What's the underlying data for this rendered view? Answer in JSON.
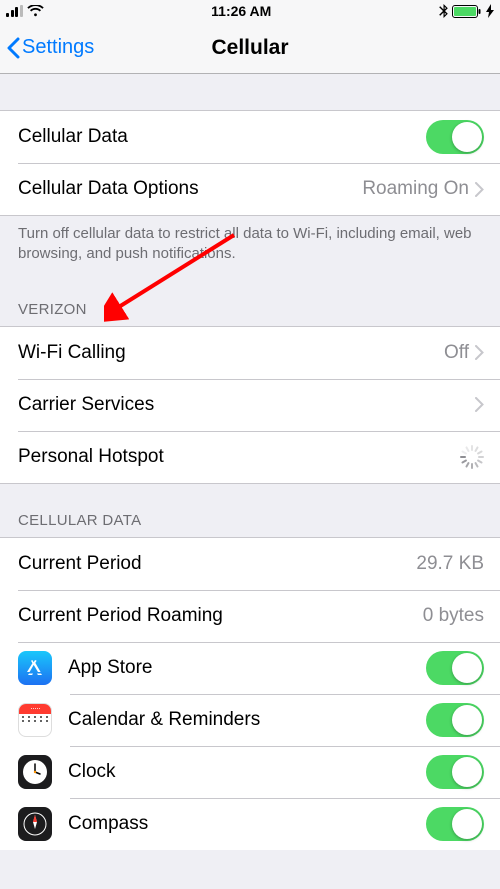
{
  "status": {
    "time": "11:26 AM"
  },
  "nav": {
    "back": "Settings",
    "title": "Cellular"
  },
  "group1": {
    "cellular_data": "Cellular Data",
    "cellular_data_options": "Cellular Data Options",
    "cellular_data_options_value": "Roaming On"
  },
  "footer1": "Turn off cellular data to restrict all data to Wi-Fi, including email, web browsing, and push notifications.",
  "carrier_header": "VERIZON",
  "group2": {
    "wifi_calling": "Wi-Fi Calling",
    "wifi_calling_value": "Off",
    "carrier_services": "Carrier Services",
    "personal_hotspot": "Personal Hotspot"
  },
  "data_header": "CELLULAR DATA",
  "group3": {
    "current_period": "Current Period",
    "current_period_value": "29.7 KB",
    "current_period_roaming": "Current Period Roaming",
    "current_period_roaming_value": "0 bytes",
    "apps": [
      {
        "name": "App Store"
      },
      {
        "name": "Calendar & Reminders"
      },
      {
        "name": "Clock"
      },
      {
        "name": "Compass"
      }
    ]
  }
}
